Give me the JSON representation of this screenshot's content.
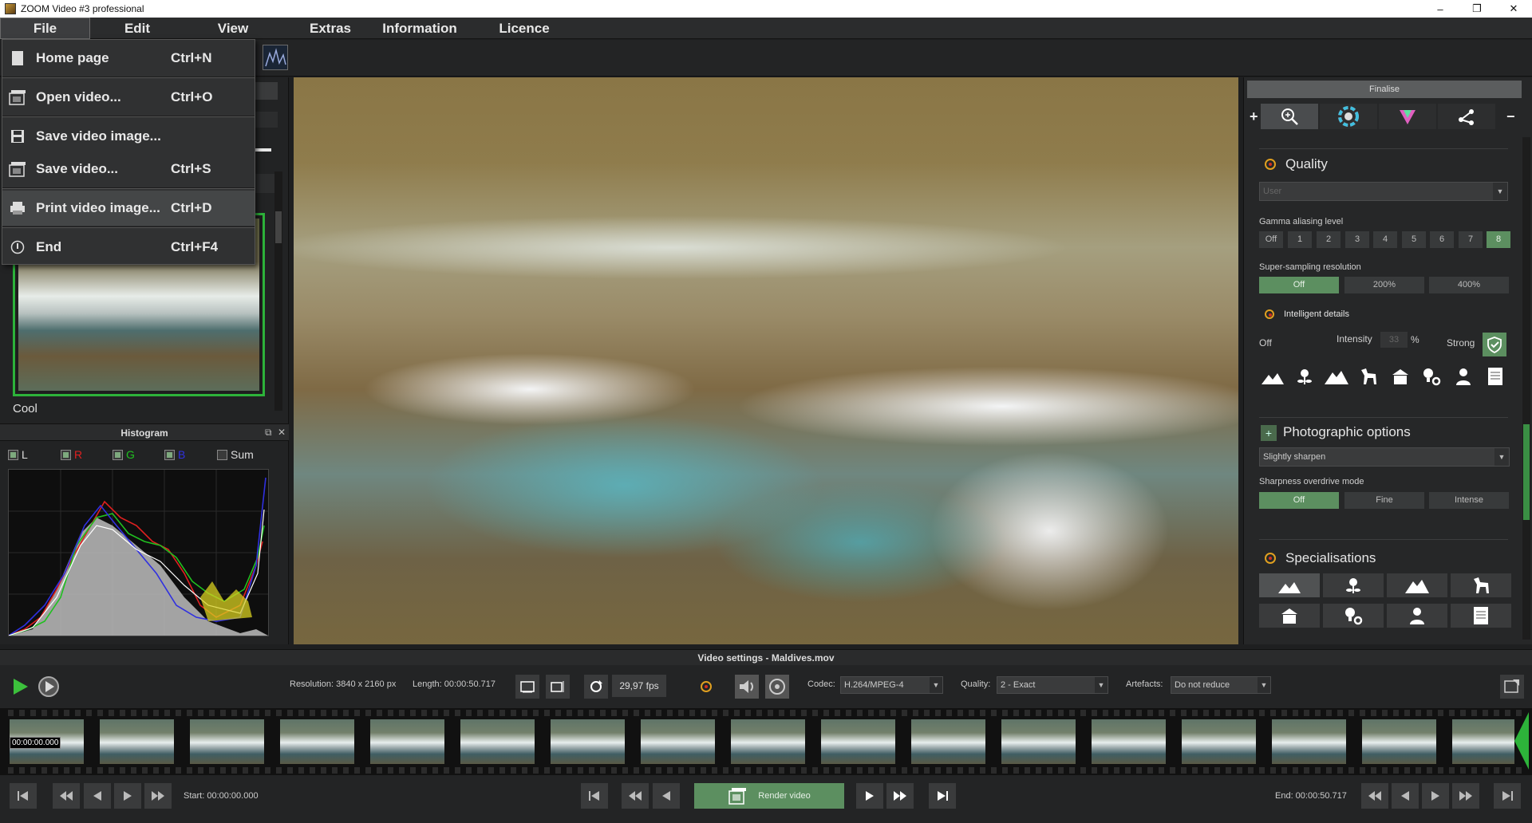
{
  "window": {
    "title": "ZOOM Video #3 professional",
    "controls": [
      "–",
      "❐",
      "✕"
    ]
  },
  "menubar": [
    {
      "label": "File",
      "active": true
    },
    {
      "label": "Edit"
    },
    {
      "label": "View"
    },
    {
      "label": "Extras"
    },
    {
      "label": "Information"
    },
    {
      "label": "Licence"
    }
  ],
  "file_menu": [
    {
      "label": "Home page",
      "shortcut": "Ctrl+N",
      "icon": "document-icon"
    },
    {
      "label": "Open video...",
      "shortcut": "Ctrl+O",
      "icon": "film-open-icon"
    },
    {
      "label": "Save video image...",
      "shortcut": "",
      "icon": "save-icon"
    },
    {
      "label": "Save video...",
      "shortcut": "Ctrl+S",
      "icon": "film-save-icon"
    },
    {
      "label": "Print video image...",
      "shortcut": "Ctrl+D",
      "icon": "printer-icon"
    },
    {
      "label": "End",
      "shortcut": "Ctrl+F4",
      "icon": "power-icon"
    }
  ],
  "left": {
    "thumb_label": "Cool",
    "histogram": {
      "title": "Histogram",
      "channels": [
        {
          "label": "L",
          "checked": true,
          "color": "#dddddd"
        },
        {
          "label": "R",
          "checked": true,
          "color": "#e02020"
        },
        {
          "label": "G",
          "checked": true,
          "color": "#20c020"
        },
        {
          "label": "B",
          "checked": true,
          "color": "#3030e0"
        },
        {
          "label": "Sum",
          "checked": false,
          "color": "#dddddd"
        }
      ]
    }
  },
  "right": {
    "header": "Finalise",
    "tab_icons": [
      "zoom-icon",
      "color-wheel-icon",
      "prism-icon",
      "graph-nodes-icon"
    ],
    "quality": {
      "title": "Quality",
      "preset": "User",
      "gamma_label": "Gamma aliasing level",
      "gamma_levels": [
        "Off",
        "1",
        "2",
        "3",
        "4",
        "5",
        "6",
        "7",
        "8"
      ],
      "gamma_selected": "8",
      "ss_label": "Super-sampling resolution",
      "ss_options": [
        "Off",
        "200%",
        "400%"
      ],
      "ss_selected": "Off",
      "intelligent_label": "Intelligent details",
      "intel_off": "Off",
      "intensity_label": "Intensity",
      "intensity_value": "33",
      "intensity_unit": "%",
      "intel_strong": "Strong"
    },
    "photo": {
      "title": "Photographic options",
      "sharpen": "Slightly sharpen",
      "overdrive_label": "Sharpness overdrive mode",
      "overdrive_options": [
        "Off",
        "Fine",
        "Intense"
      ],
      "overdrive_selected": "Off"
    },
    "specialisations": {
      "title": "Specialisations",
      "icons": [
        "landscape-icon",
        "flower-icon",
        "mountain-icon",
        "horse-icon",
        "building-icon",
        "bulb-gear-icon",
        "person-icon",
        "document-icon"
      ]
    }
  },
  "video_settings": {
    "title": "Video settings - Maldives.mov",
    "resolution": "Resolution: 3840 x 2160 px",
    "length": "Length: 00:00:50.717",
    "fps": "29,97 fps",
    "codec_label": "Codec:",
    "codec": "H.264/MPEG-4",
    "quality_label": "Quality:",
    "quality": "2 - Exact",
    "artefacts_label": "Artefacts:",
    "artefacts": "Do not reduce"
  },
  "timeline": {
    "first_timecode": "00:00:00.000",
    "frame_count": 17
  },
  "transport": {
    "start": "Start: 00:00:00.000",
    "end": "End: 00:00:50.717",
    "render": "Render video"
  },
  "colors": {
    "accent_green": "#5c8f60",
    "selection_green": "#2db33a"
  }
}
